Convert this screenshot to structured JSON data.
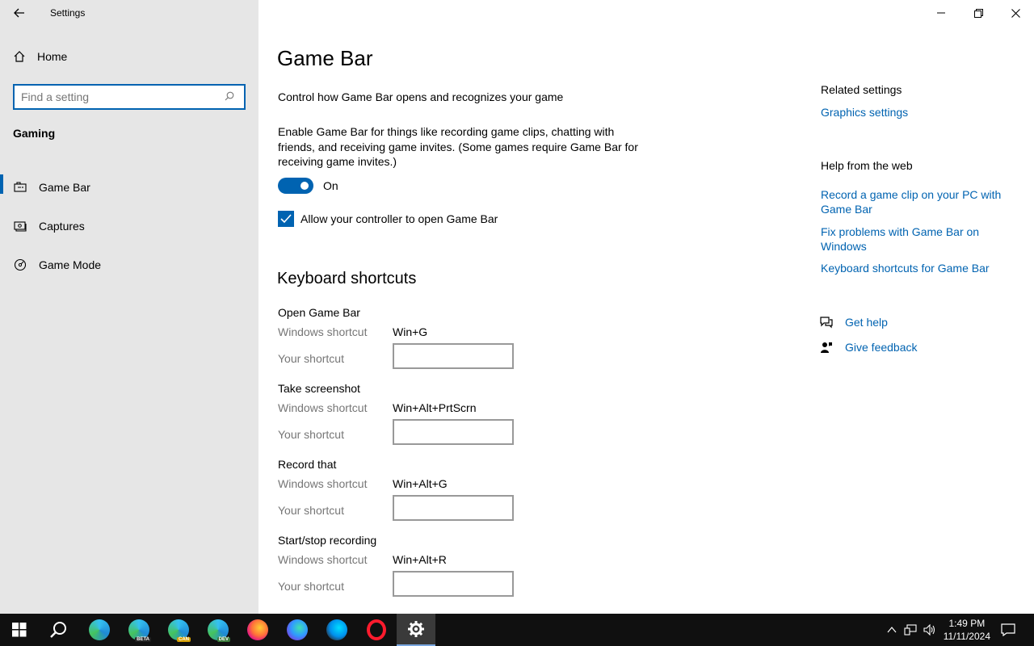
{
  "window": {
    "title": "Settings"
  },
  "sidebar": {
    "home_label": "Home",
    "search_placeholder": "Find a setting",
    "section_title": "Gaming",
    "items": [
      {
        "label": "Game Bar",
        "icon": "game-bar-icon",
        "active": true
      },
      {
        "label": "Captures",
        "icon": "captures-icon",
        "active": false
      },
      {
        "label": "Game Mode",
        "icon": "game-mode-icon",
        "active": false
      }
    ]
  },
  "main": {
    "title": "Game Bar",
    "subtitle": "Control how Game Bar opens and recognizes your game",
    "description": "Enable Game Bar for things like recording game clips, chatting with friends, and receiving game invites. (Some games require Game Bar for receiving game invites.)",
    "toggle_state": "On",
    "checkbox_label": "Allow your controller to open Game Bar",
    "shortcuts_heading": "Keyboard shortcuts",
    "windows_shortcut_label": "Windows shortcut",
    "your_shortcut_label": "Your shortcut",
    "shortcuts": [
      {
        "name": "Open Game Bar",
        "keys": "Win+G"
      },
      {
        "name": "Take screenshot",
        "keys": "Win+Alt+PrtScrn"
      },
      {
        "name": "Record that",
        "keys": "Win+Alt+G"
      },
      {
        "name": "Start/stop recording",
        "keys": "Win+Alt+R"
      }
    ]
  },
  "right_panel": {
    "related_heading": "Related settings",
    "related_links": [
      "Graphics settings"
    ],
    "help_heading": "Help from the web",
    "help_links": [
      "Record a game clip on your PC with Game Bar",
      "Fix problems with Game Bar on Windows",
      "Keyboard shortcuts for Game Bar"
    ],
    "get_help": "Get help",
    "give_feedback": "Give feedback"
  },
  "taskbar": {
    "time": "1:49 PM",
    "date": "11/11/2024",
    "apps": [
      {
        "name": "edge",
        "badge": ""
      },
      {
        "name": "edge-beta",
        "badge": "BETA"
      },
      {
        "name": "edge-canary",
        "badge": "CAN"
      },
      {
        "name": "edge-dev",
        "badge": "DEV"
      },
      {
        "name": "firefox",
        "badge": ""
      },
      {
        "name": "firefox-developer",
        "badge": ""
      },
      {
        "name": "firefox-nightly",
        "badge": ""
      },
      {
        "name": "opera",
        "badge": ""
      },
      {
        "name": "settings",
        "badge": ""
      }
    ]
  },
  "colors": {
    "accent": "#0063b1",
    "sidebar_bg": "#e6e6e6",
    "taskbar_bg": "#101010"
  }
}
